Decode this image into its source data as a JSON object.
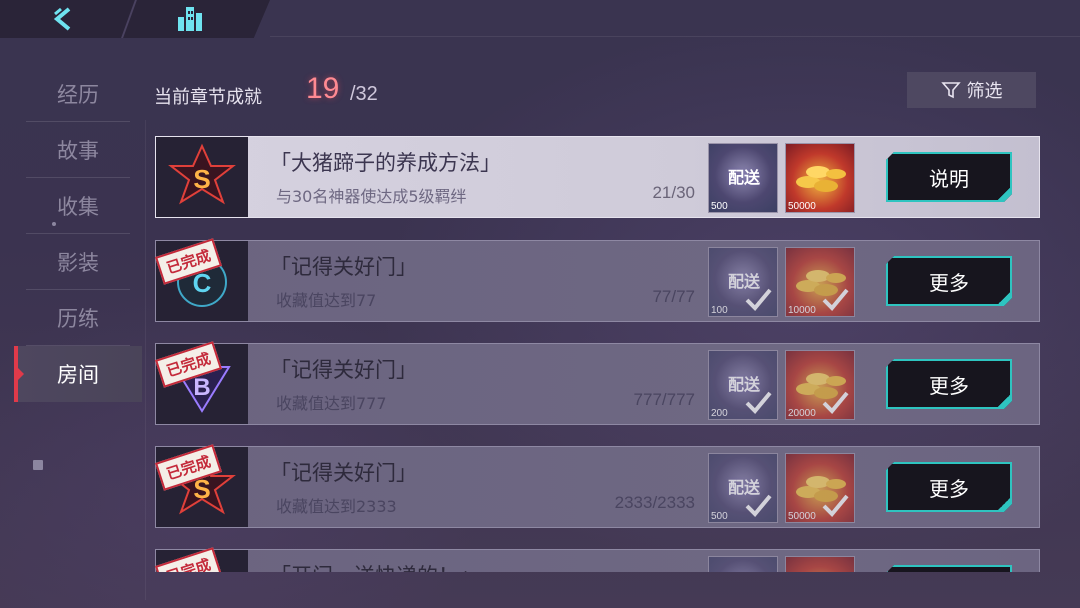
{
  "nav": {
    "back_icon": "chevron-left-icon",
    "home_icon": "building-icon"
  },
  "sidebar": {
    "items": [
      {
        "label": "经历"
      },
      {
        "label": "故事"
      },
      {
        "label": "收集"
      },
      {
        "label": "影装"
      },
      {
        "label": "历练"
      },
      {
        "label": "房间"
      }
    ],
    "active_index": 5
  },
  "header": {
    "label": "当前章节成就",
    "count": "19",
    "total": "/32",
    "filter_label": "筛选"
  },
  "colors": {
    "accent_red": "#e03a4a",
    "button_border": "#2ec4c0",
    "count_color": "#ff8a92"
  },
  "achievements": [
    {
      "badge": "S",
      "completed": false,
      "title": "「大猪蹄子的养成方法」",
      "desc": "与30名神器使达成5级羁绊",
      "progress": "21/30",
      "reward1_label": "配送",
      "reward1_amount": "500",
      "reward2_amount": "50000",
      "action": "说明"
    },
    {
      "badge": "C",
      "completed": true,
      "done_tag": "已完成",
      "title": "「记得关好门」",
      "desc": "收藏值达到77",
      "progress": "77/77",
      "reward1_label": "配送",
      "reward1_amount": "100",
      "reward2_amount": "10000",
      "action": "更多"
    },
    {
      "badge": "B",
      "completed": true,
      "done_tag": "已完成",
      "title": "「记得关好门」",
      "desc": "收藏值达到777",
      "progress": "777/777",
      "reward1_label": "配送",
      "reward1_amount": "200",
      "reward2_amount": "20000",
      "action": "更多"
    },
    {
      "badge": "S",
      "completed": true,
      "done_tag": "已完成",
      "title": "「记得关好门」",
      "desc": "收藏值达到2333",
      "progress": "2333/2333",
      "reward1_label": "配送",
      "reward1_amount": "500",
      "reward2_amount": "50000",
      "action": "更多"
    },
    {
      "badge": "S",
      "completed": true,
      "done_tag": "已完成",
      "title": "「开门，送快递的！」",
      "desc": "",
      "progress": "",
      "reward1_label": "",
      "reward1_amount": "",
      "reward2_amount": "",
      "action": ""
    }
  ]
}
